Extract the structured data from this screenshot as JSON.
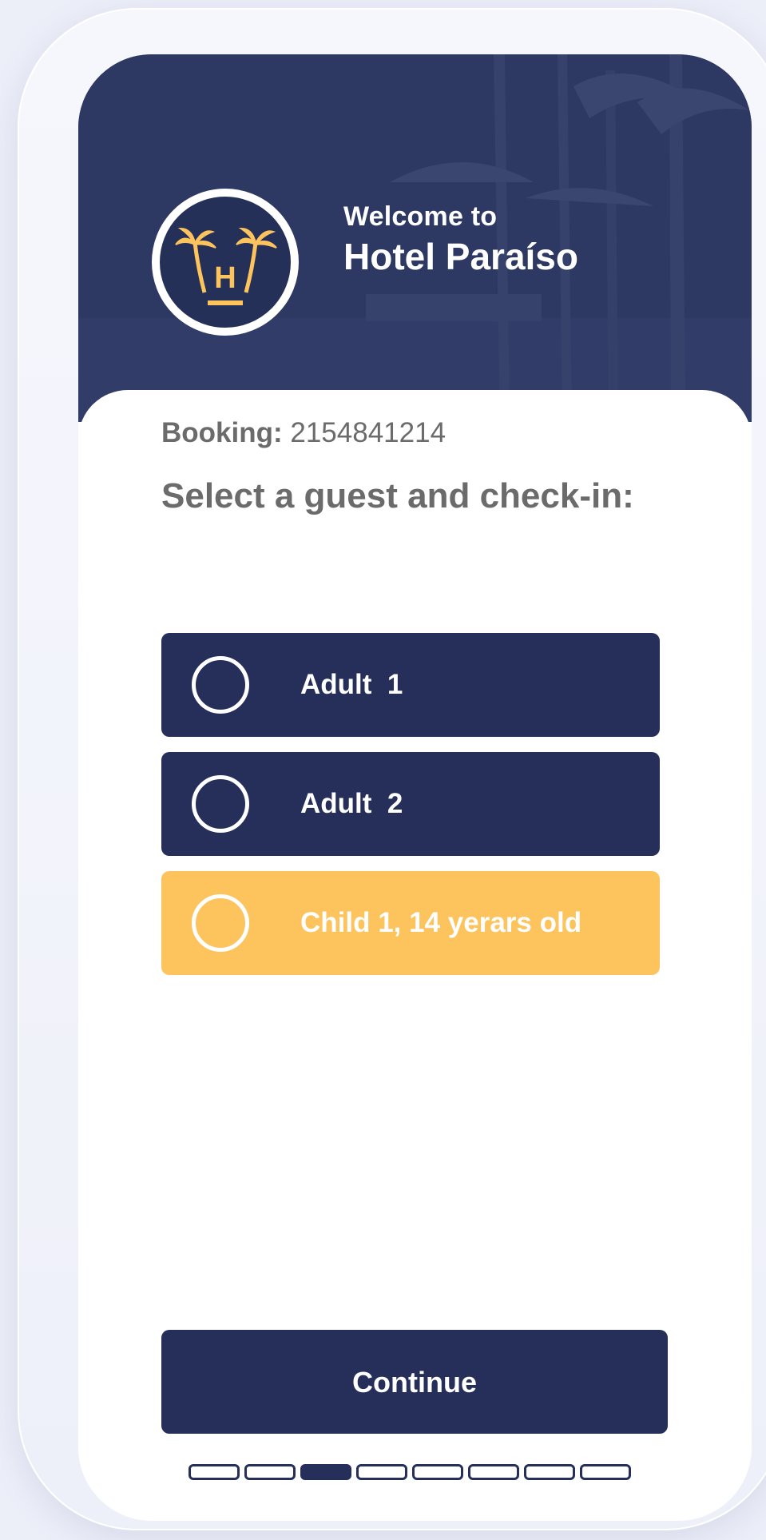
{
  "header": {
    "welcome": "Welcome to",
    "hotel_name": "Hotel Paraíso",
    "logo_icon": "palm-trees-h-logo-icon"
  },
  "booking": {
    "label": "Booking:",
    "number": "2154841214"
  },
  "prompt": "Select a guest and check-in:",
  "guests": [
    {
      "label": "Adult  1",
      "selected": false,
      "color": "#252f5a"
    },
    {
      "label": "Adult  2",
      "selected": false,
      "color": "#252f5a"
    },
    {
      "label": "Child 1, 14 yerars old",
      "selected": false,
      "color": "#fdc35d"
    }
  ],
  "continue_label": "Continue",
  "progress": {
    "total_steps": 8,
    "current_step": 3
  },
  "colors": {
    "navy": "#252f5a",
    "accent": "#fdc35d",
    "text_gray": "#6b6b6b"
  }
}
